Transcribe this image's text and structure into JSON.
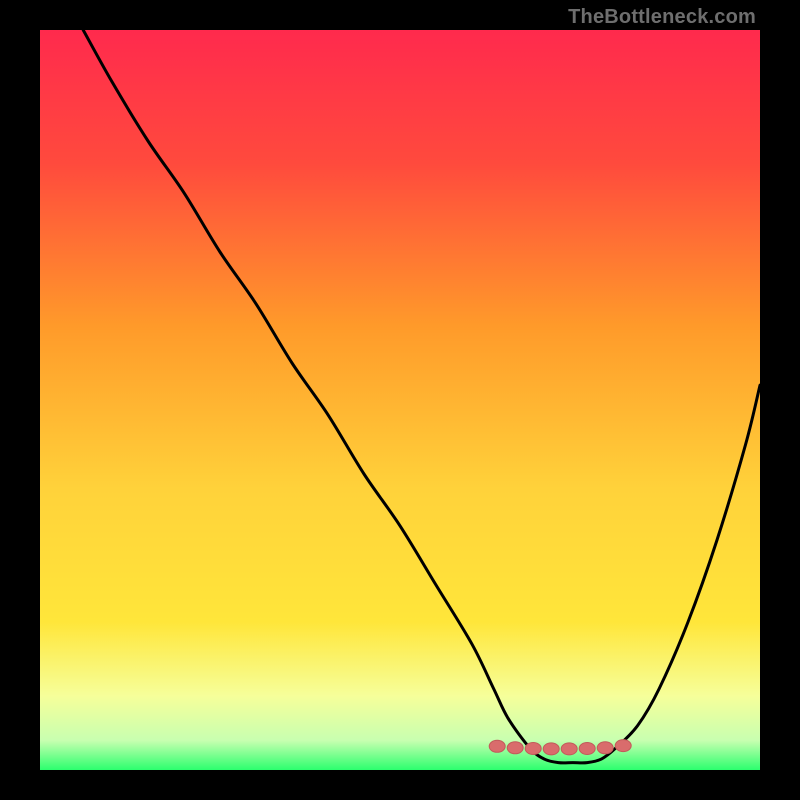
{
  "watermark": "TheBottleneck.com",
  "colors": {
    "bg": "#000000",
    "curve": "#000000",
    "marker_fill": "#d96c6c",
    "marker_stroke": "#c25a5a",
    "grad_top": "#ff2a4d",
    "grad_mid1": "#ff9a2a",
    "grad_mid2": "#ffe63a",
    "grad_low": "#f6ff9a",
    "grad_bottom": "#2cff6e"
  },
  "chart_data": {
    "type": "line",
    "title": "",
    "xlabel": "",
    "ylabel": "",
    "xlim": [
      0,
      100
    ],
    "ylim": [
      0,
      100
    ],
    "series": [
      {
        "name": "bottleneck-curve",
        "x": [
          6,
          10,
          15,
          20,
          25,
          30,
          35,
          40,
          45,
          50,
          55,
          60,
          63,
          65,
          68,
          70,
          72,
          74,
          76,
          78,
          80,
          83,
          86,
          90,
          94,
          98,
          100
        ],
        "y": [
          100,
          93,
          85,
          78,
          70,
          63,
          55,
          48,
          40,
          33,
          25,
          17,
          11,
          7,
          3,
          1.5,
          1,
          1,
          1,
          1.5,
          3,
          6,
          11,
          20,
          31,
          44,
          52
        ]
      }
    ],
    "markers": {
      "name": "optimal-range",
      "x": [
        63.5,
        66,
        68.5,
        71,
        73.5,
        76,
        78.5,
        81
      ],
      "y": [
        3.2,
        3.0,
        2.9,
        2.85,
        2.85,
        2.9,
        3.0,
        3.3
      ]
    }
  }
}
